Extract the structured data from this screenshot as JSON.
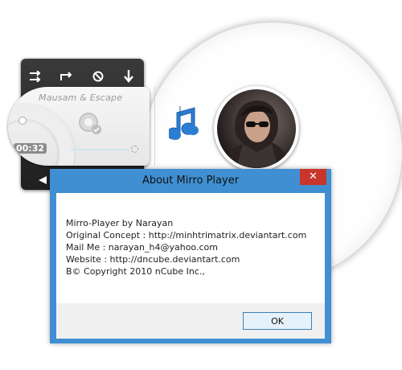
{
  "player": {
    "song_title": "Mausam & Escape",
    "time": "00:32",
    "controls": [
      "shuffle-icon",
      "repeat-icon",
      "stop-icon",
      "download-icon"
    ]
  },
  "dialog": {
    "title": "About Mirro Player",
    "close_label": "✕",
    "lines": [
      "Mirro-Player by Narayan",
      "Original Concept : http://minhtrimatrix.deviantart.com",
      "Mail Me : narayan_h4@yahoo.com",
      "Website : http://dncube.deviantart.com",
      "B© Copyright 2010 nCube Inc.,"
    ],
    "ok_label": "OK"
  },
  "colors": {
    "dialog_frame": "#3f8fd2",
    "close_button": "#c7352b",
    "note_blue": "#2b7fd3"
  }
}
